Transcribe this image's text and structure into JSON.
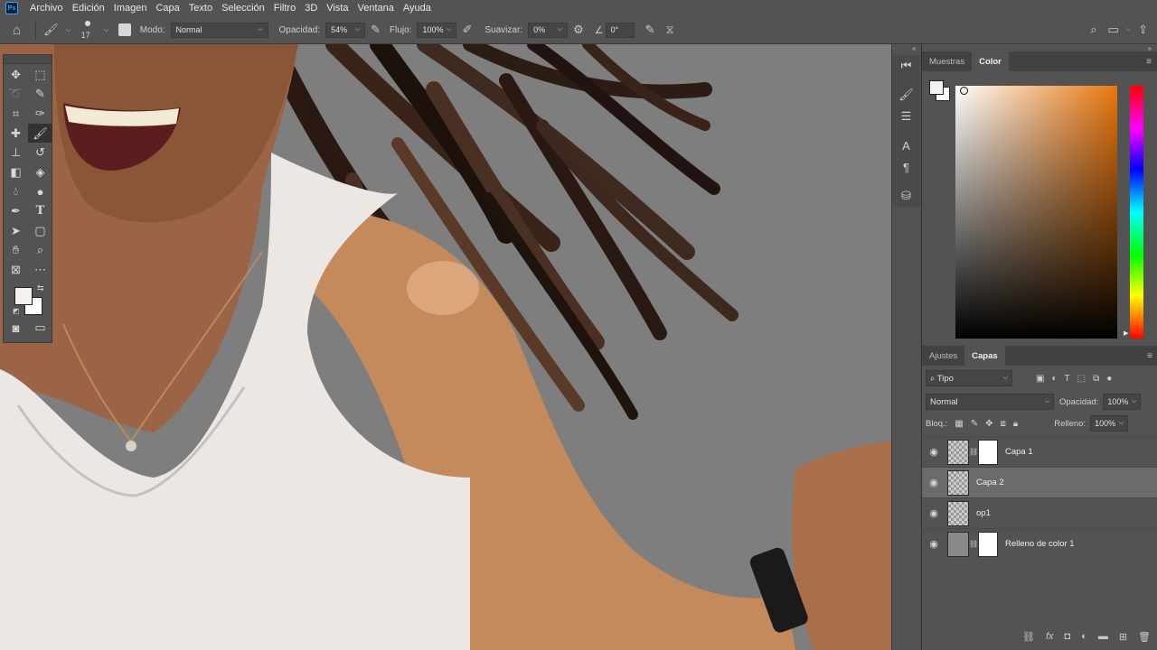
{
  "app": {
    "logo": "Ps"
  },
  "menu": [
    "Archivo",
    "Edición",
    "Imagen",
    "Capa",
    "Texto",
    "Selección",
    "Filtro",
    "3D",
    "Vista",
    "Ventana",
    "Ayuda"
  ],
  "options": {
    "brush_size": "17",
    "mode_label": "Modo:",
    "mode_value": "Normal",
    "opacity_label": "Opacidad:",
    "opacity_value": "54%",
    "flow_label": "Flujo:",
    "flow_value": "100%",
    "smooth_label": "Suavizar:",
    "smooth_value": "0%",
    "angle_value": "0°"
  },
  "color_panel": {
    "tabs": [
      "Muestras",
      "Color"
    ],
    "foreground": "#f5f1ef",
    "background": "#ffffff",
    "hue_color": "#e8760e"
  },
  "layers_panel": {
    "tabs": [
      "Ajustes",
      "Capas"
    ],
    "filter_value": "Tipo",
    "blend_mode": "Normal",
    "opacity_label": "Opacidad:",
    "opacity_value": "100%",
    "lock_label": "Bloq.:",
    "fill_label": "Relleno:",
    "fill_value": "100%",
    "layers": [
      {
        "name": "Capa 1"
      },
      {
        "name": "Capa 2"
      },
      {
        "name": "op1"
      },
      {
        "name": "Relleno de color 1"
      }
    ]
  }
}
